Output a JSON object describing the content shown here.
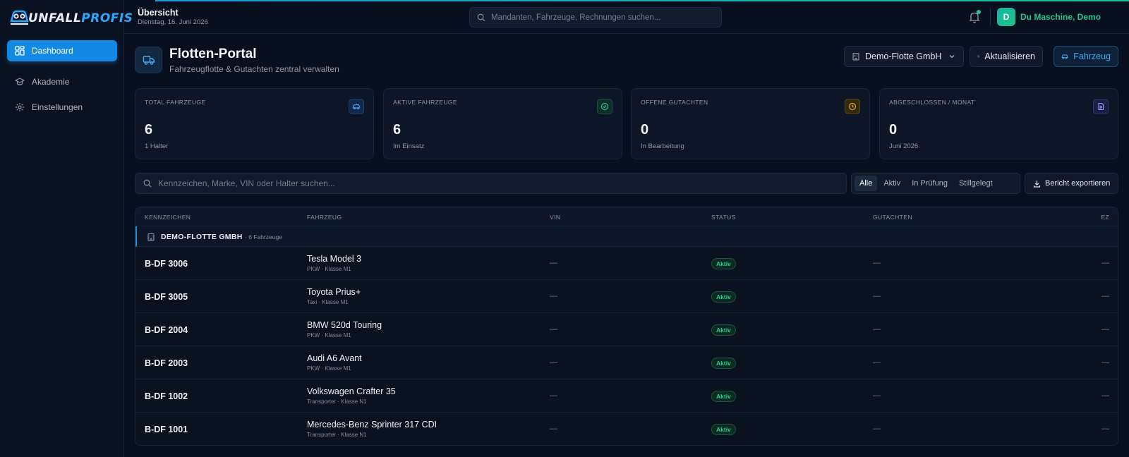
{
  "brand": {
    "logo_text_a": "UNFALL",
    "logo_text_b": "PROFIS"
  },
  "sidebar": {
    "items": [
      {
        "label": "Dashboard",
        "icon": "dashboard-grid-icon",
        "active": true
      },
      {
        "label": "Akademie",
        "icon": "graduation-cap-icon",
        "active": false
      },
      {
        "label": "Einstellungen",
        "icon": "gear-icon",
        "active": false
      }
    ]
  },
  "header": {
    "title": "Übersicht",
    "date": "Dienstag, 16. Juni 2026",
    "search_placeholder": "Mandanten, Fahrzeuge, Rechnungen suchen...",
    "avatar_initial": "D",
    "user_name": "Du Maschine, Demo"
  },
  "page": {
    "title": "Flotten-Portal",
    "subtitle": "Fahrzeugflotte & Gutachten zentral verwalten",
    "fleet_select": "Demo-Flotte GmbH",
    "refresh_label": "Aktualisieren",
    "vehicle_label": "Fahrzeug"
  },
  "stats": [
    {
      "label": "TOTAL FAHRZEUGE",
      "value": "6",
      "sub": "1 Halter",
      "icon": "car-icon",
      "color": "#2d8fe6"
    },
    {
      "label": "AKTIVE FAHRZEUGE",
      "value": "6",
      "sub": "Im Einsatz",
      "icon": "check-circle-icon",
      "color": "#22c58f"
    },
    {
      "label": "OFFENE GUTACHTEN",
      "value": "0",
      "sub": "In Bearbeitung",
      "icon": "clock-icon",
      "color": "#e0a72a"
    },
    {
      "label": "ABGESCHLOSSEN / MONAT",
      "value": "0",
      "sub": "Juni 2026",
      "icon": "document-icon",
      "color": "#7f8cf0"
    }
  ],
  "table_search_placeholder": "Kennzeichen, Marke, VIN oder Halter suchen...",
  "filters": [
    "Alle",
    "Aktiv",
    "In Prüfung",
    "Stillgelegt"
  ],
  "active_filter": "Alle",
  "export_label": "Bericht exportieren",
  "table": {
    "columns": [
      "KENNZEICHEN",
      "FAHRZEUG",
      "VIN",
      "STATUS",
      "GUTACHTEN",
      "EZ"
    ],
    "group": {
      "name": "DEMO-FLOTTE GMBH",
      "count": "· 6 Fahrzeuge"
    },
    "rows": [
      {
        "plate": "B-DF 3006",
        "model": "Tesla Model 3",
        "meta": "PKW · Klasse M1",
        "vin": "—",
        "status": "Aktiv",
        "gutachten": "—",
        "ez": "—"
      },
      {
        "plate": "B-DF 3005",
        "model": "Toyota Prius+",
        "meta": "Taxi · Klasse M1",
        "vin": "—",
        "status": "Aktiv",
        "gutachten": "—",
        "ez": "—"
      },
      {
        "plate": "B-DF 2004",
        "model": "BMW 520d Touring",
        "meta": "PKW · Klasse M1",
        "vin": "—",
        "status": "Aktiv",
        "gutachten": "—",
        "ez": "—"
      },
      {
        "plate": "B-DF 2003",
        "model": "Audi A6 Avant",
        "meta": "PKW · Klasse M1",
        "vin": "—",
        "status": "Aktiv",
        "gutachten": "—",
        "ez": "—"
      },
      {
        "plate": "B-DF 1002",
        "model": "Volkswagen Crafter 35",
        "meta": "Transporter · Klasse N1",
        "vin": "—",
        "status": "Aktiv",
        "gutachten": "—",
        "ez": "—"
      },
      {
        "plate": "B-DF 1001",
        "model": "Mercedes-Benz Sprinter 317 CDI",
        "meta": "Transporter · Klasse N1",
        "vin": "—",
        "status": "Aktiv",
        "gutachten": "—",
        "ez": "—"
      }
    ]
  }
}
